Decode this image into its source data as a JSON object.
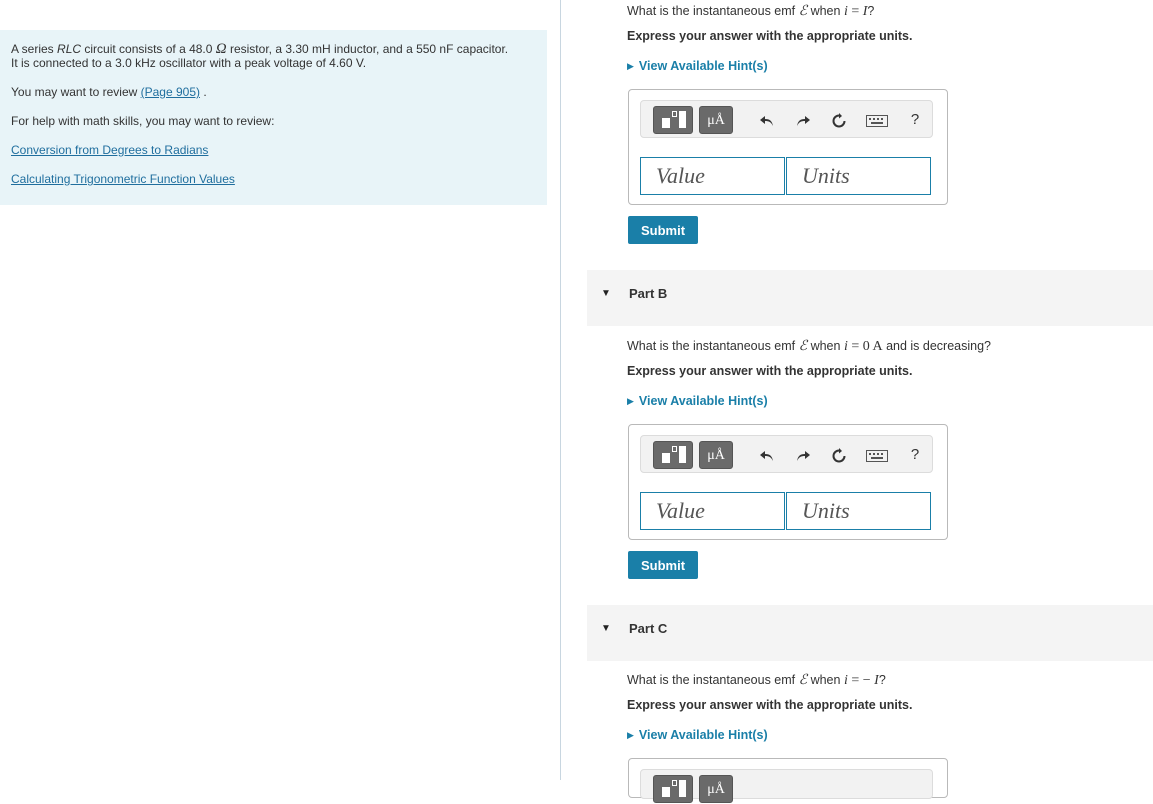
{
  "problem": {
    "statement_pre": "A series ",
    "statement_rlc": "RLC",
    "statement_mid1": " circuit consists of a 48.0 ",
    "ohm_symbol": "Ω",
    "statement_rest": " resistor, a 3.30 mH inductor, and a 550 nF capacitor. It is connected to a 3.0 kHz oscillator with a peak voltage of 4.60 V.",
    "review_prefix": "You may want to review ",
    "review_link": "(Page 905)",
    "review_suffix": " .",
    "help_text": "For help with math skills, you may want to review:",
    "link1": "Conversion from Degrees to Radians",
    "link2": "Calculating Trigonometric Function Values"
  },
  "part_a": {
    "q_prefix": "What is the instantaneous emf ",
    "emf_symbol": "ℰ",
    "q_when": " when ",
    "q_i": "i",
    "q_eq": " = ",
    "q_val": "I",
    "q_end": "?",
    "express": "Express your answer with the appropriate units.",
    "hint": "View Available Hint(s)",
    "value_placeholder": "Value",
    "units_placeholder": "Units",
    "submit": "Submit"
  },
  "part_b": {
    "header": "Part B",
    "q_prefix": "What is the instantaneous emf ",
    "emf_symbol": "ℰ",
    "q_when": " when ",
    "q_i": "i",
    "q_eq": " = ",
    "q_val": "0 A",
    "q_end": " and is decreasing?",
    "express": "Express your answer with the appropriate units.",
    "hint": "View Available Hint(s)",
    "value_placeholder": "Value",
    "units_placeholder": "Units",
    "submit": "Submit"
  },
  "part_c": {
    "header": "Part C",
    "q_prefix": "What is the instantaneous emf ",
    "emf_symbol": "ℰ",
    "q_when": " when ",
    "q_i": "i",
    "q_eq": " = ",
    "q_minus": "− ",
    "q_val": "I",
    "q_end": "?",
    "express": "Express your answer with the appropriate units.",
    "hint": "View Available Hint(s)"
  },
  "toolbar": {
    "units_label": "μÅ",
    "help_label": "?"
  },
  "icons": {
    "caret": "triangle-down-icon",
    "hint": "triangle-right-icon",
    "undo": "undo-icon",
    "redo": "redo-icon",
    "reset": "reset-icon",
    "keyboard": "keyboard-icon"
  }
}
